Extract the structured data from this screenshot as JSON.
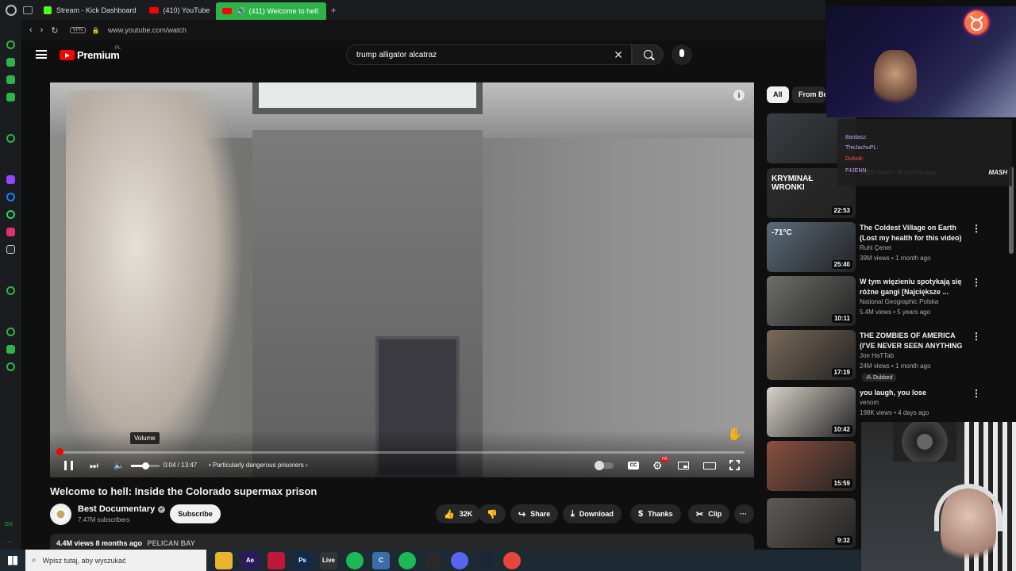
{
  "browser": {
    "tabs": [
      {
        "title": "Stream - Kick Dashboard"
      },
      {
        "title": "(410) YouTube"
      },
      {
        "title": "(411) Welcome to hell:"
      }
    ],
    "vpn_label": "VPN",
    "url": "www.youtube.com/watch"
  },
  "sidebar": {
    "bottom_label": "GX"
  },
  "youtube": {
    "logo_text": "Premium",
    "region": "PL",
    "search_value": "trump alligator alcatraz"
  },
  "player": {
    "tooltip": "Volume",
    "time": "0:04 / 13:47",
    "chapter": "• Particularly dangerous prisoners",
    "progress_fraction": 0.005,
    "volume_fraction": 0.5
  },
  "video": {
    "title": "Welcome to hell: Inside the Colorado supermax prison",
    "channel": "Best Documentary",
    "subscribers": "7.47M subscribers",
    "subscribe_label": "Subscribe",
    "likes": "32K",
    "share_label": "Share",
    "download_label": "Download",
    "thanks_label": "Thanks",
    "clip_label": "Clip",
    "views_date": "4.4M views  8 months ago",
    "tag": "PELICAN BAY"
  },
  "chips": {
    "all": "All",
    "from": "From Be"
  },
  "recommendations": [
    {
      "duration": "",
      "title": "",
      "channel": "",
      "meta": "",
      "color": "#3a3e44"
    },
    {
      "duration": "22:53",
      "title": "",
      "channel": "",
      "meta": "543K views • 8 months ago",
      "color": "#2c2b2b",
      "thumb_text": "KRYMINAŁ WRONKI"
    },
    {
      "duration": "25:40",
      "title": "The Coldest Village on Earth (Lost my health for this video) ...",
      "channel": "Ruhi Çenet",
      "meta": "39M views • 1 month ago",
      "color": "#5b6b7a",
      "thumb_text": "-71°C"
    },
    {
      "duration": "10:11",
      "title": "W tym więzieniu spotykają się różne gangi [Najciększe ...",
      "channel": "National Geographic Polska",
      "meta": "5.4M views • 5 years ago",
      "color": "#6e6f6a"
    },
    {
      "duration": "17:19",
      "title": "THE ZOMBIES OF AMERICA (I'VE NEVER SEEN ANYTHING ...",
      "channel": "Joe HaTTab",
      "meta": "24M views • 1 month ago",
      "dubbed": "Dubbed",
      "color": "#7a6a5a"
    },
    {
      "duration": "10:42",
      "title": "you laugh, you lose",
      "channel": "venom",
      "meta": "198K views • 4 days ago",
      "color": "#d8d2c8"
    },
    {
      "duration": "15:59",
      "title": "",
      "channel": "",
      "meta": "",
      "color": "#8a5040"
    },
    {
      "duration": "9:32",
      "title": "",
      "channel": "",
      "meta": "",
      "color": "#5e5a58"
    }
  ],
  "chat": {
    "lines": [
      {
        "user": "Bardasz:",
        "color": "#c9a4ff"
      },
      {
        "user": "TheJachuPL:",
        "color": "#c9a4ff"
      },
      {
        "user": "Dubsik:",
        "color": "#ff4a4a"
      },
      {
        "user": "F4JENN:",
        "color": "#c9a4ff"
      }
    ],
    "brand": "MASH"
  },
  "taskbar": {
    "search_placeholder": "Wpisz tutaj, aby wyszukać",
    "apps": [
      {
        "name": "file-explorer",
        "label": "",
        "color": "#e8b52a"
      },
      {
        "name": "after-effects",
        "label": "Ae",
        "color": "#2a1a5e"
      },
      {
        "name": "opera-gx",
        "label": "",
        "color": "#c0183a"
      },
      {
        "name": "photoshop",
        "label": "Ps",
        "color": "#0f2a4a"
      },
      {
        "name": "live",
        "label": "Live",
        "color": "#333333"
      },
      {
        "name": "spotify",
        "label": "",
        "color": "#1db954"
      },
      {
        "name": "ccleaner",
        "label": "C",
        "color": "#3b6ea8"
      },
      {
        "name": "spotify-2",
        "label": "",
        "color": "#1db954"
      },
      {
        "name": "obs",
        "label": "",
        "color": "#2a2a2a"
      },
      {
        "name": "discord",
        "label": "",
        "color": "#5865f2"
      },
      {
        "name": "steam",
        "label": "",
        "color": "#1b2838"
      },
      {
        "name": "chrome",
        "label": "",
        "color": "#e8453c"
      }
    ]
  }
}
